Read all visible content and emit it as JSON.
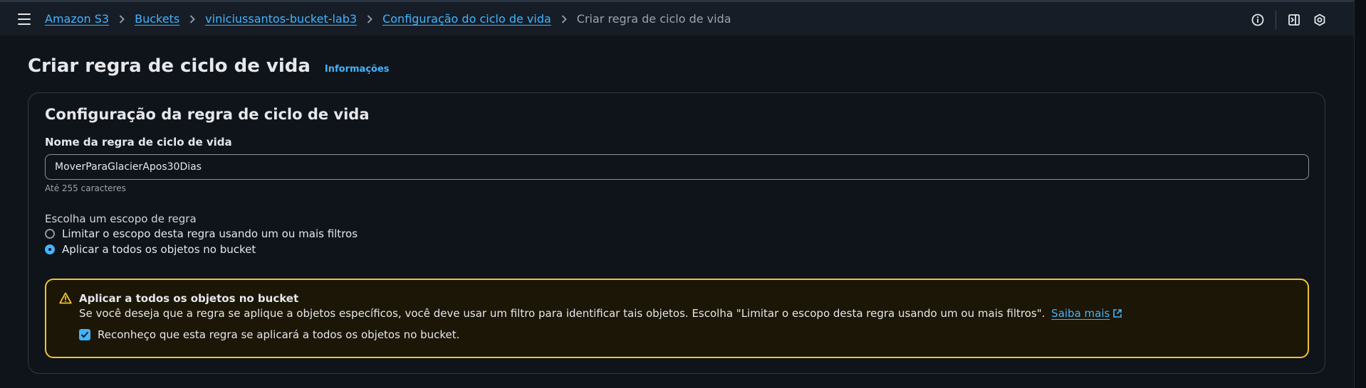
{
  "breadcrumbs": {
    "items": [
      "Amazon S3",
      "Buckets",
      "viniciussantos-bucket-lab3",
      "Configuração do ciclo de vida"
    ],
    "current": "Criar regra de ciclo de vida"
  },
  "header": {
    "title": "Criar regra de ciclo de vida",
    "info_link": "Informações"
  },
  "top_actions": {
    "icons": [
      "info-icon",
      "notifications-panel-icon",
      "settings-hex-icon"
    ]
  },
  "config": {
    "section_title": "Configuração da regra de ciclo de vida",
    "name_label": "Nome da regra de ciclo de vida",
    "name_value": "MoverParaGlacierApos30Dias",
    "name_hint": "Até 255 caracteres",
    "scope_label": "Escolha um escopo de regra",
    "scope_options": [
      {
        "label": "Limitar o escopo desta regra usando um ou mais filtros",
        "selected": false
      },
      {
        "label": "Aplicar a todos os objetos no bucket",
        "selected": true
      }
    ]
  },
  "alert": {
    "title": "Aplicar a todos os objetos no bucket",
    "text": "Se você deseja que a regra se aplique a objetos específicos, você deve usar um filtro para identificar tais objetos. Escolha \"Limitar o escopo desta regra usando um ou mais filtros\".",
    "link": "Saiba mais",
    "ack_label": "Reconheço que esta regra se aplicará a todos os objetos no bucket.",
    "ack_checked": true
  },
  "colors": {
    "accent": "#42b4ff",
    "warning": "#f2c232",
    "background": "#0f141a"
  }
}
